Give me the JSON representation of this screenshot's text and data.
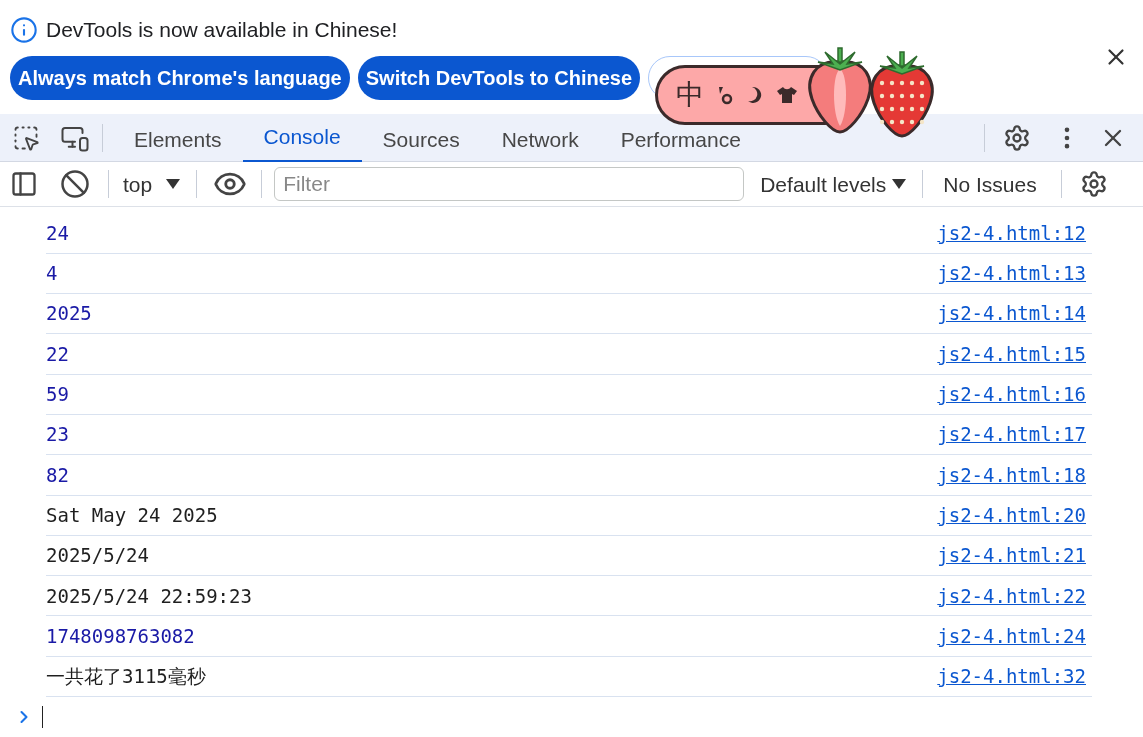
{
  "banner": {
    "message": "DevTools is now available in Chinese!",
    "buttons": [
      {
        "label": "Always match Chrome's language",
        "kind": "primary"
      },
      {
        "label": "Switch DevTools to Chinese",
        "kind": "primary"
      },
      {
        "kind": "outline"
      }
    ]
  },
  "tabs": [
    {
      "label": "Elements",
      "selected": false
    },
    {
      "label": "Console",
      "selected": true
    },
    {
      "label": "Sources",
      "selected": false
    },
    {
      "label": "Network",
      "selected": false
    },
    {
      "label": "Performance",
      "selected": false
    }
  ],
  "ime": {
    "mode": "中"
  },
  "toolbar": {
    "context": "top",
    "filter_placeholder": "Filter",
    "levels": "Default levels",
    "issues": "No Issues"
  },
  "messages": [
    {
      "text": "24",
      "kind": "number",
      "source": "js2-4.html:12"
    },
    {
      "text": "4",
      "kind": "number",
      "source": "js2-4.html:13"
    },
    {
      "text": "2025",
      "kind": "number",
      "source": "js2-4.html:14"
    },
    {
      "text": "22",
      "kind": "number",
      "source": "js2-4.html:15"
    },
    {
      "text": "59",
      "kind": "number",
      "source": "js2-4.html:16"
    },
    {
      "text": "23",
      "kind": "number",
      "source": "js2-4.html:17"
    },
    {
      "text": "82",
      "kind": "number",
      "source": "js2-4.html:18"
    },
    {
      "text": "Sat May 24 2025",
      "kind": "string",
      "source": "js2-4.html:20"
    },
    {
      "text": "2025/5/24",
      "kind": "string",
      "source": "js2-4.html:21"
    },
    {
      "text": "2025/5/24 22:59:23",
      "kind": "string",
      "source": "js2-4.html:22"
    },
    {
      "text": "1748098763082",
      "kind": "number",
      "source": "js2-4.html:24"
    },
    {
      "text": "一共花了3115毫秒",
      "kind": "string",
      "source": "js2-4.html:32"
    }
  ]
}
